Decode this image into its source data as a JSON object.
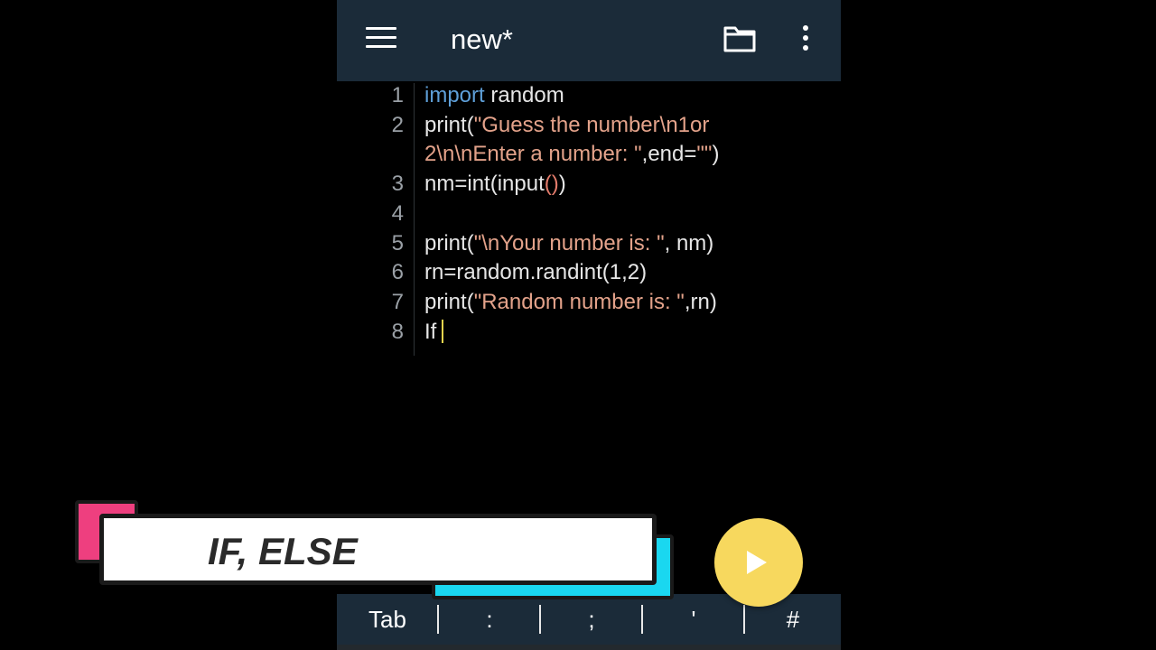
{
  "app_bar": {
    "title": "new*",
    "icons": [
      "menu-icon",
      "folder-icon",
      "more-vert-icon"
    ]
  },
  "editor": {
    "line_numbers": [
      "1",
      "2",
      "",
      "3",
      "4",
      "5",
      "6",
      "7",
      "8"
    ],
    "lines": [
      [
        {
          "t": "import",
          "c": "kw"
        },
        {
          "t": " random",
          "c": ""
        }
      ],
      [
        {
          "t": "print(",
          "c": ""
        },
        {
          "t": "\"Guess the number\\n1or",
          "c": "str"
        }
      ],
      [
        {
          "t": "2\\n\\nEnter a number: \"",
          "c": "str"
        },
        {
          "t": ",end=",
          "c": ""
        },
        {
          "t": "\"\"",
          "c": "str"
        },
        {
          "t": ")",
          "c": ""
        }
      ],
      [
        {
          "t": "nm=int(input",
          "c": ""
        },
        {
          "t": "()",
          "c": "paren"
        },
        {
          "t": ")",
          "c": ""
        }
      ],
      [],
      [
        {
          "t": "print(",
          "c": ""
        },
        {
          "t": "\"\\nYour number is: \"",
          "c": "str"
        },
        {
          "t": ", nm)",
          "c": ""
        }
      ],
      [
        {
          "t": "rn=random.randint(1,2)",
          "c": ""
        }
      ],
      [
        {
          "t": "print(",
          "c": ""
        },
        {
          "t": "\"Random number is: \"",
          "c": "str"
        },
        {
          "t": ",rn)",
          "c": ""
        }
      ],
      [
        {
          "t": "If",
          "c": ""
        }
      ]
    ]
  },
  "keys": [
    "Tab",
    ":",
    ";",
    "'",
    "#"
  ],
  "run_button": {
    "icon": "play-icon"
  },
  "caption": {
    "text": "IF, ELSE"
  },
  "colors": {
    "app_bar": "#1b2b39",
    "keyword": "#5e9fd8",
    "string": "#e3a28a",
    "caret": "#e8d44d",
    "fab": "#f7d85e",
    "caption_pink": "#ee3f7f",
    "caption_cyan": "#1ad7f0"
  }
}
